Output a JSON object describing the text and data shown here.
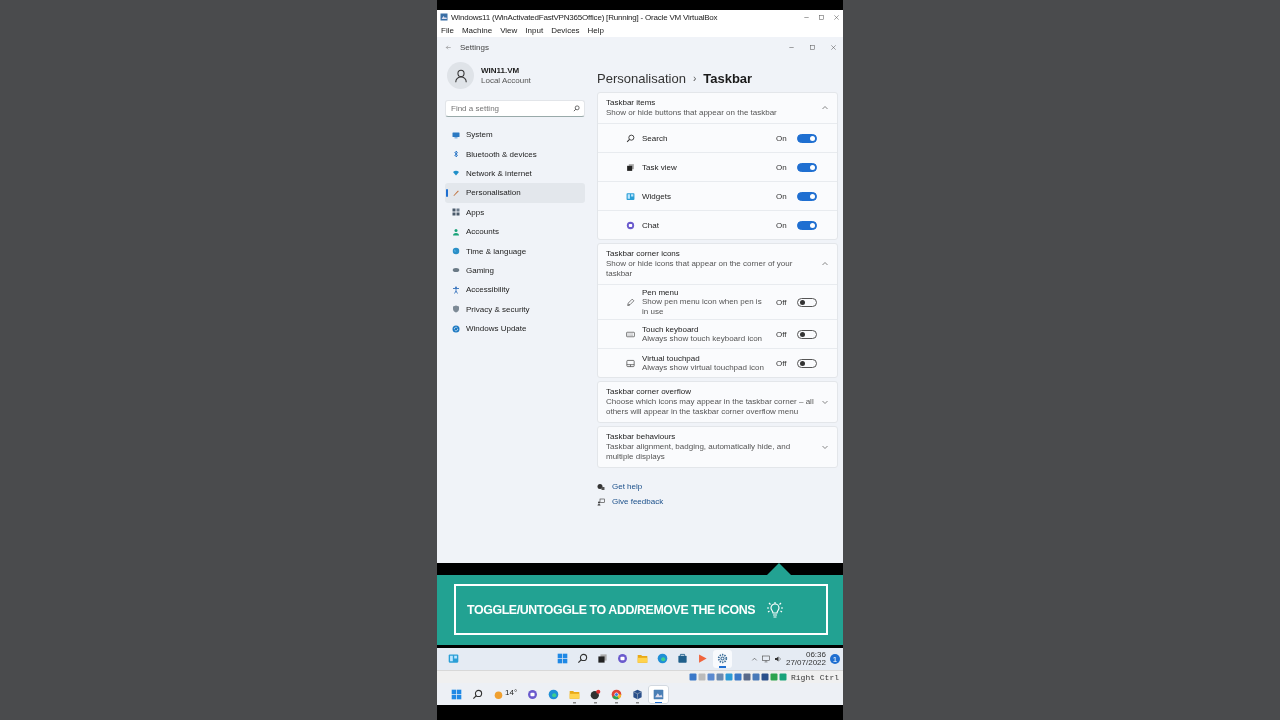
{
  "vbox": {
    "title": "Windows11 (WinActivatedFastVPN365Office) [Running] - Oracle VM VirtualBox",
    "menu": [
      "File",
      "Machine",
      "View",
      "Input",
      "Devices",
      "Help"
    ],
    "host_key": "Right Ctrl"
  },
  "settings": {
    "title": "Settings",
    "user": {
      "name": "WIN11.VM",
      "account": "Local Account"
    },
    "search": {
      "placeholder": "Find a setting"
    },
    "nav": [
      {
        "label": "System",
        "selected": false
      },
      {
        "label": "Bluetooth & devices",
        "selected": false
      },
      {
        "label": "Network & internet",
        "selected": false
      },
      {
        "label": "Personalisation",
        "selected": true
      },
      {
        "label": "Apps",
        "selected": false
      },
      {
        "label": "Accounts",
        "selected": false
      },
      {
        "label": "Time & language",
        "selected": false
      },
      {
        "label": "Gaming",
        "selected": false
      },
      {
        "label": "Accessibility",
        "selected": false
      },
      {
        "label": "Privacy & security",
        "selected": false
      },
      {
        "label": "Windows Update",
        "selected": false
      }
    ],
    "breadcrumb": {
      "parent": "Personalisation",
      "separator": "›",
      "current": "Taskbar"
    },
    "sections": [
      {
        "title": "Taskbar items",
        "subtitle": "Show or hide buttons that appear on the taskbar",
        "expanded": true,
        "rows": [
          {
            "label": "Search",
            "on": true,
            "state": "On"
          },
          {
            "label": "Task view",
            "on": true,
            "state": "On"
          },
          {
            "label": "Widgets",
            "on": true,
            "state": "On"
          },
          {
            "label": "Chat",
            "on": true,
            "state": "On"
          }
        ]
      },
      {
        "title": "Taskbar corner icons",
        "subtitle": "Show or hide icons that appear on the corner of your taskbar",
        "expanded": true,
        "rows": [
          {
            "label": "Pen menu",
            "description": "Show pen menu icon when pen is in use",
            "on": false,
            "state": "Off"
          },
          {
            "label": "Touch keyboard",
            "description": "Always show touch keyboard icon",
            "on": false,
            "state": "Off"
          },
          {
            "label": "Virtual touchpad",
            "description": "Always show virtual touchpad icon",
            "on": false,
            "state": "Off"
          }
        ]
      },
      {
        "title": "Taskbar corner overflow",
        "subtitle": "Choose which icons may appear in the taskbar corner – all others will appear in the taskbar corner overflow menu",
        "expanded": false
      },
      {
        "title": "Taskbar behaviours",
        "subtitle": "Taskbar alignment, badging, automatically hide, and multiple displays",
        "expanded": false
      }
    ],
    "links": [
      "Get help",
      "Give feedback"
    ]
  },
  "banner": {
    "text": "TOGGLE/UNTOGGLE TO ADD/REMOVE THE ICONS"
  },
  "vm_taskbar": {
    "left": [
      {
        "active": false
      }
    ],
    "apps": [
      {
        "active": false
      },
      {
        "active": false
      },
      {
        "active": false
      },
      {
        "active": false
      },
      {
        "active": false
      },
      {
        "active": false
      },
      {
        "active": false
      },
      {
        "active": false
      },
      {
        "active": true
      }
    ],
    "time": "06:36",
    "date": "27/07/2022",
    "badge": "1"
  },
  "host_taskbar": {
    "apps": [
      {
        "running": false,
        "active": false
      },
      {
        "running": false,
        "active": false
      },
      {
        "running": false,
        "active": false,
        "label": "14°"
      },
      {
        "running": false,
        "active": false
      },
      {
        "running": false,
        "active": false
      },
      {
        "running": true,
        "active": false
      },
      {
        "running": true,
        "active": false
      },
      {
        "running": true,
        "active": false
      },
      {
        "running": true,
        "active": false
      },
      {
        "running": true,
        "active": true
      }
    ]
  }
}
